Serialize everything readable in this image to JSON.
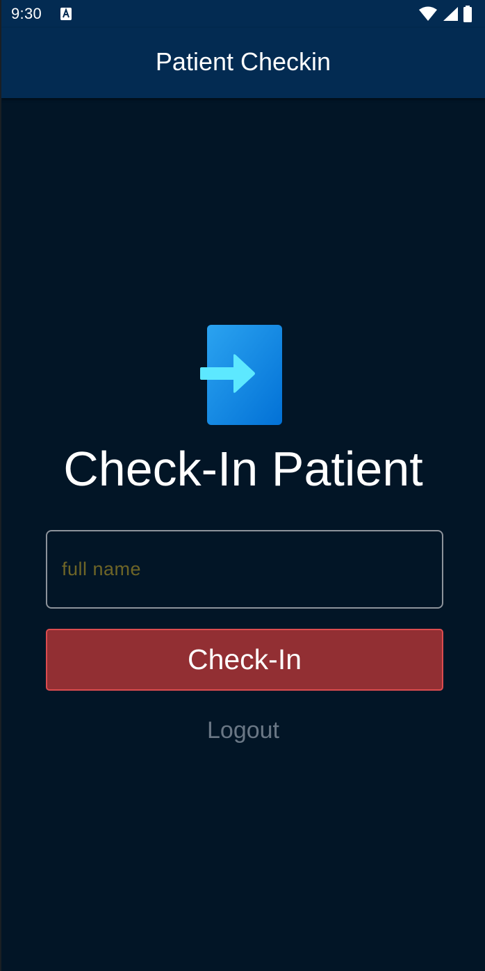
{
  "status_bar": {
    "time": "9:30",
    "icons": [
      "notification-a-icon",
      "wifi-icon",
      "signal-icon",
      "battery-icon"
    ]
  },
  "app_bar": {
    "title": "Patient Checkin"
  },
  "main": {
    "hero_icon": "login-arrow-icon",
    "headline": "Check-In Patient",
    "name_field": {
      "value": "",
      "placeholder": "full name"
    },
    "checkin_button_label": "Check-In",
    "logout_label": "Logout"
  },
  "colors": {
    "app_bar": "#032b52",
    "background": "#021526",
    "button": "#922f33",
    "button_border": "#dc4c4f",
    "placeholder": "#6e6527",
    "icon_primary": "#0a7fe0",
    "icon_arrow": "#5de8ff",
    "logout_text": "#6a7785"
  }
}
